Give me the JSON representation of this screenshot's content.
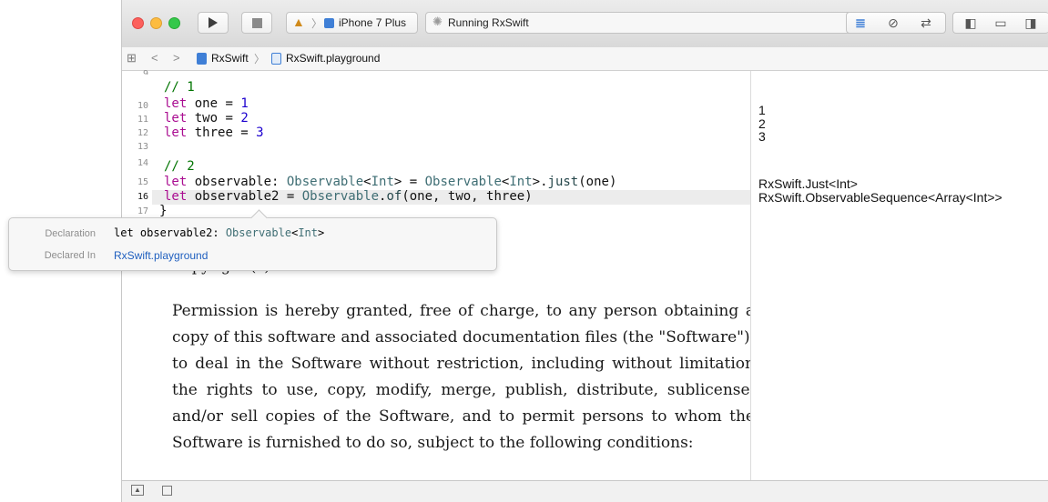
{
  "toolbar": {
    "scheme_device": "iPhone 7 Plus",
    "status": "Running RxSwift"
  },
  "jumpbar": {
    "project": "RxSwift",
    "file": "RxSwift.playground"
  },
  "code": {
    "line_numbers": [
      "9",
      "10",
      "11",
      "12",
      "13",
      "14",
      "15",
      "16",
      "17"
    ],
    "comment1": "// 1",
    "l10": {
      "kw": "let",
      "name": " one = ",
      "num": "1"
    },
    "l11": {
      "kw": "let",
      "name": " two = ",
      "num": "2"
    },
    "l12": {
      "kw": "let",
      "name": " three = ",
      "num": "3"
    },
    "comment2": "// 2",
    "l15": {
      "kw": "let",
      "name": " observable: ",
      "t1": "Observable",
      "lt1": "<",
      "t2": "Int",
      "gt1": "> = ",
      "t3": "Observable",
      "lt2": "<",
      "t4": "Int",
      "gt2": ">.",
      "fn": "just",
      "args": "(one)"
    },
    "l16": {
      "kw": "let",
      "name": " observable2 = ",
      "t1": "Observable",
      "dot": ".",
      "fn": "of",
      "args": "(one, two, three)"
    },
    "l17": "}"
  },
  "results": {
    "r1": "1",
    "r2": "2",
    "r3": "3",
    "r4": "RxSwift.Just<Int>",
    "r5": "RxSwift.ObservableSequence<Array<Int>>"
  },
  "doc": {
    "copyright": "Copyright (c) 2014-2016 Razeware LLC",
    "body": "Permission is hereby granted, free of charge, to any person obtaining a copy of this software and associated documentation files (the \"Software\"), to deal in the Software without restriction, including without limitation the rights to use, copy, modify, merge, publish, distribute, sublicense, and/or sell copies of the Software, and to permit persons to whom the Software is furnished to do so, subject to the following conditions:"
  },
  "popover": {
    "declaration_label": "Declaration",
    "declaration_prefix": "let observable2: ",
    "declaration_type": "Observable",
    "declaration_lt": "<",
    "declaration_int": "Int",
    "declaration_gt": ">",
    "declared_in_label": "Declared In",
    "declared_in_value": "RxSwift.playground"
  },
  "colors": {
    "close": "#fc605c",
    "minimize": "#fdbc40",
    "zoom": "#34c84a",
    "accent_blue": "#3f7fd6"
  }
}
